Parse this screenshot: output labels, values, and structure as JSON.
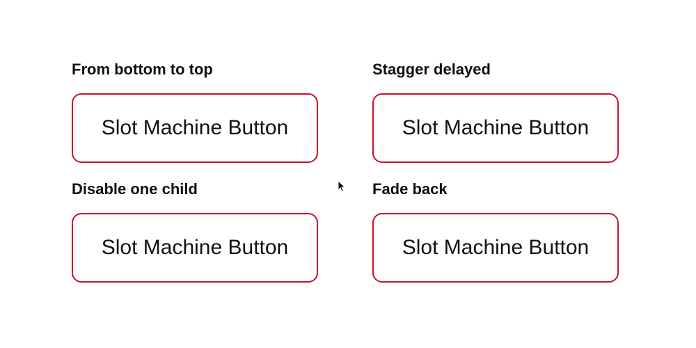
{
  "accent_color": "#c8102e",
  "sections": [
    {
      "label": "From bottom to top",
      "button_label": "Slot Machine Button"
    },
    {
      "label": "Stagger delayed",
      "button_label": "Slot Machine Button"
    },
    {
      "label": "Disable one child",
      "button_label": "Slot Machine Button"
    },
    {
      "label": "Fade back",
      "button_label": "Slot Machine Button"
    }
  ],
  "cursor_icon": "mouse-pointer-icon"
}
